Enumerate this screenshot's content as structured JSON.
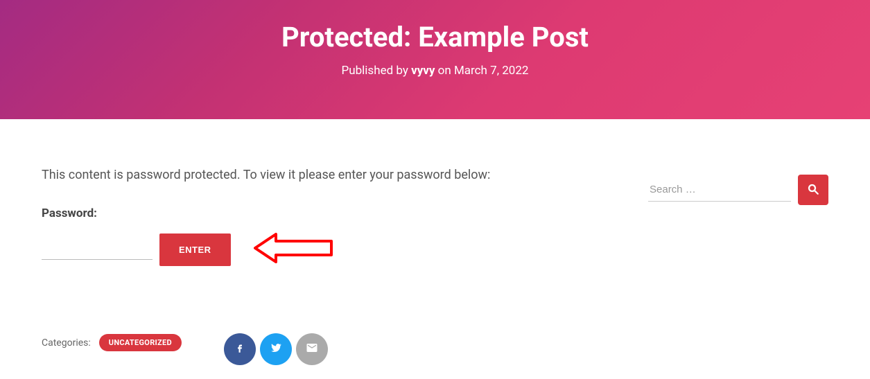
{
  "hero": {
    "title": "Protected: Example Post",
    "published_prefix": "Published by ",
    "author": "vyvy",
    "published_suffix": " on March 7, 2022"
  },
  "content": {
    "intro": "This content is password protected. To view it please enter your password below:",
    "password_label": "Password:",
    "enter_label": "ENTER"
  },
  "categories": {
    "label": "Categories:",
    "items": [
      "UNCATEGORIZED"
    ]
  },
  "sidebar": {
    "search_placeholder": "Search …"
  },
  "icons": {
    "search": "search-icon",
    "facebook": "facebook-icon",
    "twitter": "twitter-icon",
    "email": "email-icon",
    "arrow": "arrow-annotation"
  },
  "colors": {
    "accent": "#d9363e",
    "hero_start": "#a42b82",
    "hero_end": "#e64174",
    "facebook": "#3b5998",
    "twitter": "#1da1f2",
    "mail": "#aaaaaa"
  }
}
